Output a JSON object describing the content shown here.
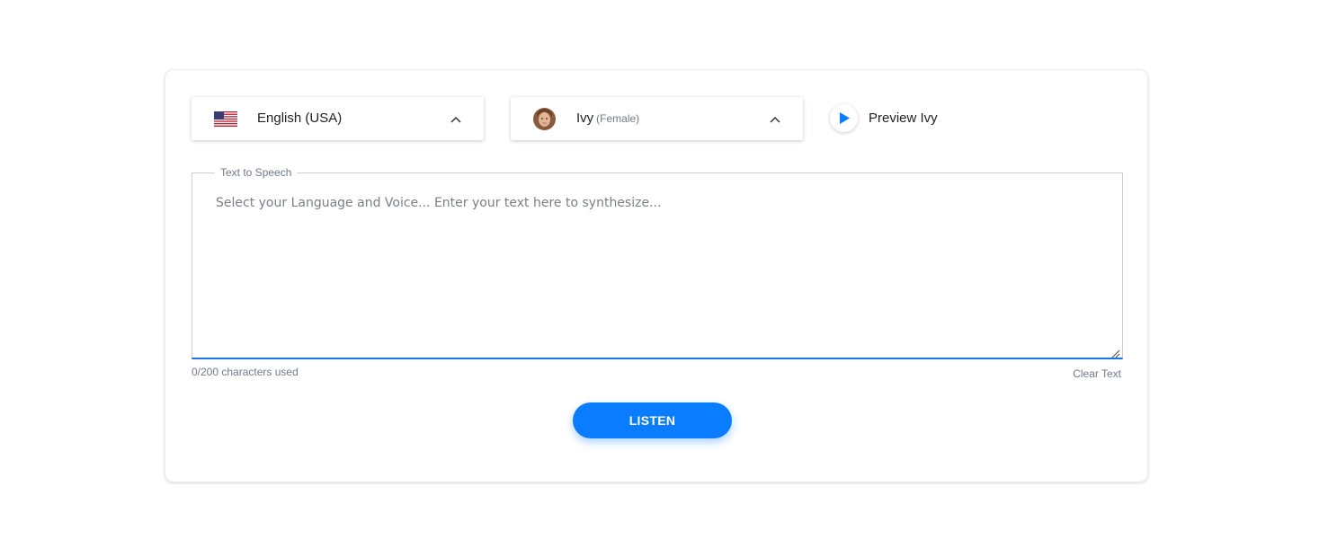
{
  "language_select": {
    "label": "English (USA)",
    "icon": "us-flag-icon"
  },
  "voice_select": {
    "name": "Ivy",
    "gender": "(Female)",
    "icon": "avatar"
  },
  "preview": {
    "label": "Preview Ivy",
    "icon": "play-icon"
  },
  "tts": {
    "legend": "Text to Speech",
    "value": "",
    "placeholder": "Select your Language and Voice... Enter your text here to synthesize..."
  },
  "footer": {
    "char_count": "0/200 characters used",
    "clear_label": "Clear Text"
  },
  "listen_button": {
    "label": "LISTEN"
  },
  "colors": {
    "accent": "#0a7cff",
    "focus_underline": "#1a73e8",
    "muted_text": "#6f7a8a"
  }
}
